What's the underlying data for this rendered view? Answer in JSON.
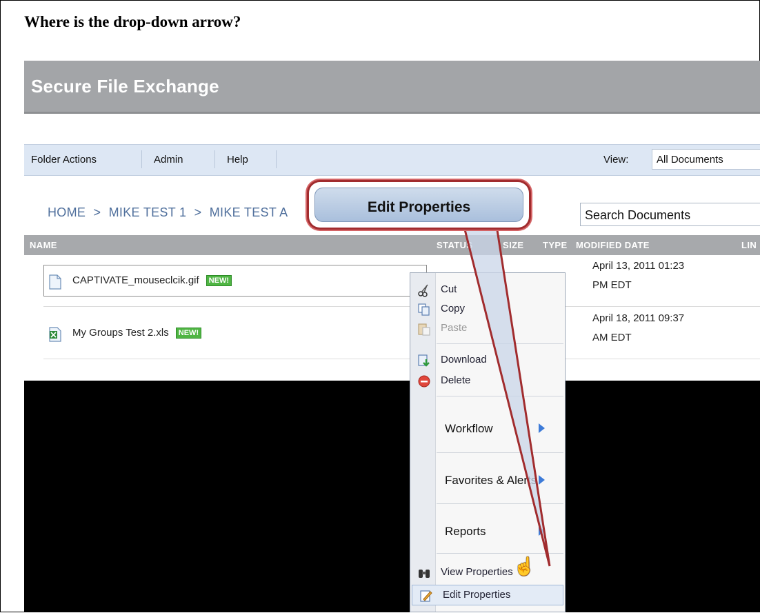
{
  "question": "Where is the drop-down arrow?",
  "app": {
    "title": "Secure File Exchange"
  },
  "toolbar": {
    "items": [
      "Folder Actions",
      "Admin",
      "Help"
    ],
    "view_label": "View:",
    "view_value": "All Documents"
  },
  "breadcrumb": {
    "items": [
      "HOME",
      ">",
      "MIKE TEST 1",
      ">",
      "MIKE TEST A"
    ]
  },
  "search": {
    "value": "Search Documents"
  },
  "table": {
    "columns": [
      "NAME",
      "STATUS",
      "SIZE",
      "TYPE",
      "MODIFIED DATE",
      "LIN"
    ],
    "rows": [
      {
        "name": "CAPTIVATE_mouseclcik.gif",
        "badge": "NEW!",
        "date_line1": "April 13, 2011 01:23",
        "date_line2": "PM EDT",
        "icon": "image-file-icon"
      },
      {
        "name": "My Groups Test 2.xls",
        "badge": "NEW!",
        "date_line1": "April 18, 2011 09:37",
        "date_line2": "AM EDT",
        "icon": "excel-file-icon"
      }
    ]
  },
  "context_menu": {
    "items": [
      {
        "label": "Cut",
        "icon": "scissors-icon"
      },
      {
        "label": "Copy",
        "icon": "copy-icon"
      },
      {
        "label": "Paste",
        "icon": "paste-icon",
        "disabled": true
      },
      {
        "label": "Download",
        "icon": "download-icon"
      },
      {
        "label": "Delete",
        "icon": "delete-icon"
      },
      {
        "label": "Workflow",
        "submenu": true
      },
      {
        "label": "Favorites & Alerts",
        "submenu": true
      },
      {
        "label": "Reports",
        "submenu": true
      },
      {
        "label": "View Properties",
        "icon": "binoculars-icon"
      },
      {
        "label": "Edit Properties",
        "icon": "edit-icon",
        "hover": true
      }
    ]
  },
  "callout": {
    "text": "Edit Properties"
  },
  "colors": {
    "header": "#a3a5a8",
    "toolbar": "#dde7f4",
    "breadcrumb": "#4f6f9c",
    "callout_border": "#a12c2e",
    "badge": "#4fb543",
    "submenu_arrow": "#3d7bd8"
  }
}
